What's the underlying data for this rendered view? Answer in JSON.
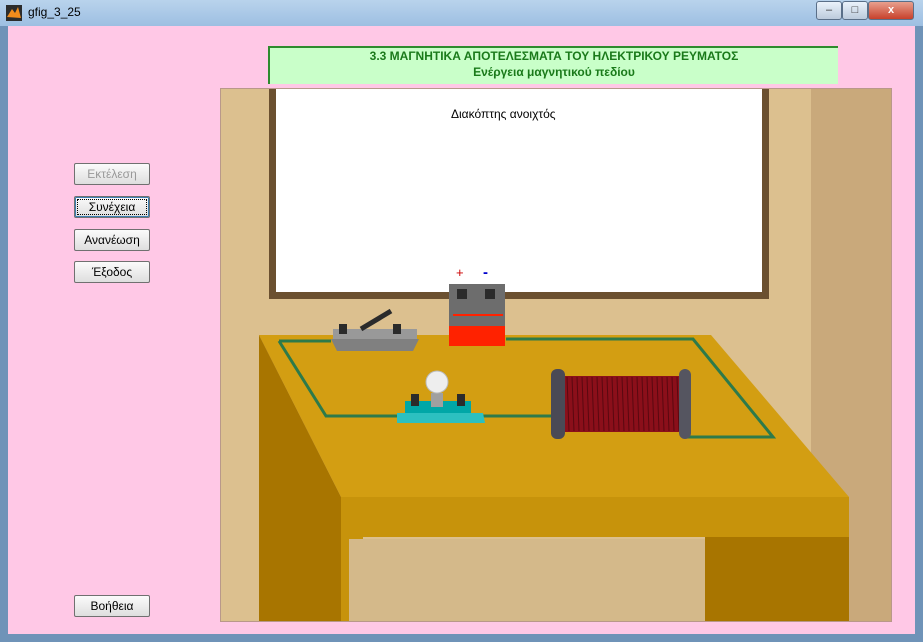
{
  "window": {
    "title": "gfig_3_25",
    "minimize": "–",
    "maximize": "□",
    "close": "x"
  },
  "header": {
    "line1": "3.3 ΜΑΓΝΗΤΙΚΑ ΑΠΟΤΕΛΕΣΜΑΤΑ ΤΟΥ ΗΛΕΚΤΡΙΚΟΥ ΡΕΥΜΑΤΟΣ",
    "line2": "Ενέργεια μαγνητικού πεδίου"
  },
  "buttons": {
    "run": "Εκτέλεση",
    "next": "Συνέχεια",
    "refresh": "Ανανέωση",
    "exit": "Έξοδος",
    "help": "Βοήθεια"
  },
  "scene": {
    "status_text": "Διακόπτης ανοιχτός",
    "battery_plus": "+",
    "battery_minus": "-",
    "colors": {
      "wall": "#dcc08f",
      "wall_right": "#c9a97b",
      "board_frame": "#6b5030",
      "table_top": "#d39e12",
      "table_front": "#c7930b",
      "table_side": "#a87500",
      "wire": "#2d7a4a",
      "coil": "#8b0f1a",
      "battery_red": "#ff2200"
    }
  }
}
